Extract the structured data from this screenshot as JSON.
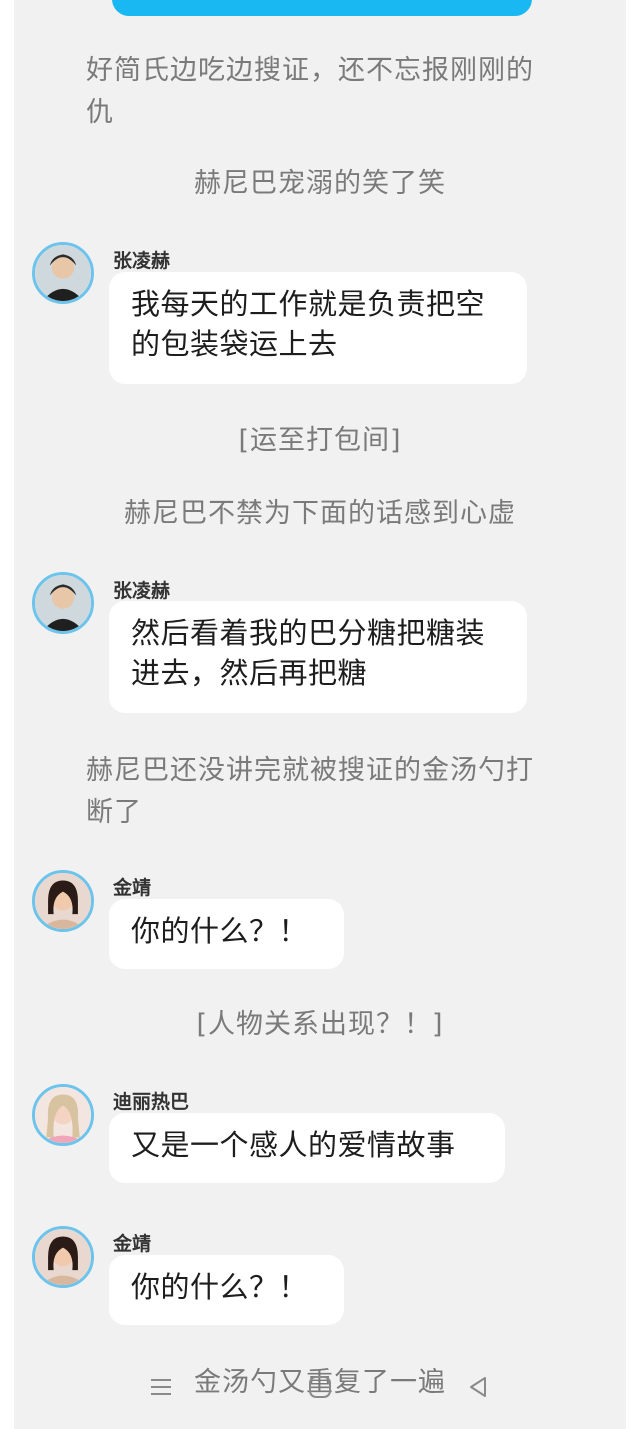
{
  "messages": {
    "n1": "好简氏边吃边搜证，还不忘报刚刚的仇",
    "n2": "赫尼巴宠溺的笑了笑",
    "m1": {
      "name": "张凌赫",
      "text": "我每天的工作就是负责把空的包装袋运上去"
    },
    "n3": "[运至打包间]",
    "n4": "赫尼巴不禁为下面的话感到心虚",
    "m2": {
      "name": "张凌赫",
      "text": "然后看着我的巴分糖把糖装进去，然后再把糖"
    },
    "n5": "赫尼巴还没讲完就被搜证的金汤勺打断了",
    "m3": {
      "name": "金靖",
      "text": "你的什么？！"
    },
    "n6": "[人物关系出现？！]",
    "m4": {
      "name": "迪丽热巴",
      "text": "又是一个感人的爱情故事"
    },
    "m5": {
      "name": "金靖",
      "text": "你的什么？！"
    },
    "n7": "金汤勺又重复了一遍"
  },
  "icons": {
    "avatar_zhang": "avatar-male-icon",
    "avatar_jin": "avatar-female-icon",
    "avatar_dili": "avatar-female-blonde-icon",
    "nav_menu": "menu-icon",
    "nav_home": "home-icon",
    "nav_back": "back-icon"
  },
  "colors": {
    "accent": "#1ab8f2",
    "avatar_border": "#6cc3ec",
    "panel_bg": "#f1f1f1"
  }
}
